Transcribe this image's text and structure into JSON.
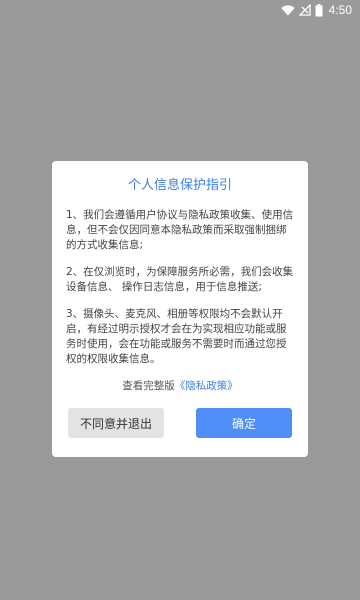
{
  "status_bar": {
    "time": "4:50",
    "wifi_icon": "wifi-icon",
    "signal_icon": "signal-icon",
    "battery_icon": "battery-icon"
  },
  "dialog": {
    "title": "个人信息保护指引",
    "paragraphs": [
      "1、我们会遵循用户协议与隐私政策收集、使用信息，但不会仅因同意本隐私政策而采取强制捆绑的方式收集信息;",
      "2、在仅浏览时，为保障服务所必需，我们会收集设备信息、 操作日志信息，用于信息推送;",
      "3、摄像头、麦克风、相册等权限均不会默认开启，有经过明示授权才会在为实现相应功能或服务时使用，会在功能或服务不需要时而通过您授权的权限收集信息。"
    ],
    "policy_prefix": "查看完整版",
    "policy_link": "《隐私政策》",
    "decline_label": "不同意并退出",
    "confirm_label": "确定"
  },
  "colors": {
    "overlay": "#9a9a9a",
    "accent": "#3d7ee8",
    "confirm_button": "#4f8ef7",
    "decline_button": "#e3e3e3"
  }
}
